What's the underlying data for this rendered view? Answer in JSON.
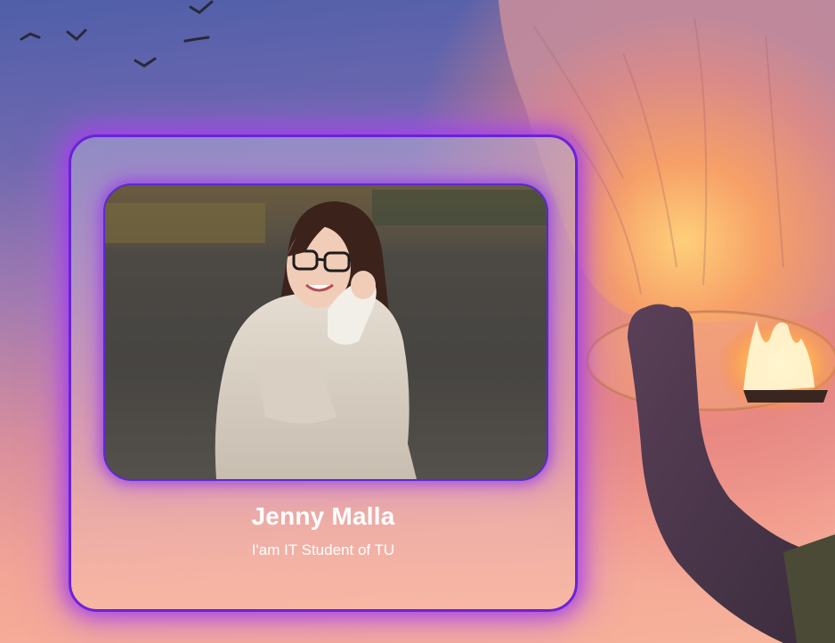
{
  "profile": {
    "name": "Jenny Malla",
    "role": "I'am IT Student of TU"
  },
  "colors": {
    "card_border": "#6a22d8",
    "card_glow": "#a03ceb",
    "text": "#ffffff"
  },
  "background": {
    "icon": "sky-lantern-scene-icon"
  }
}
